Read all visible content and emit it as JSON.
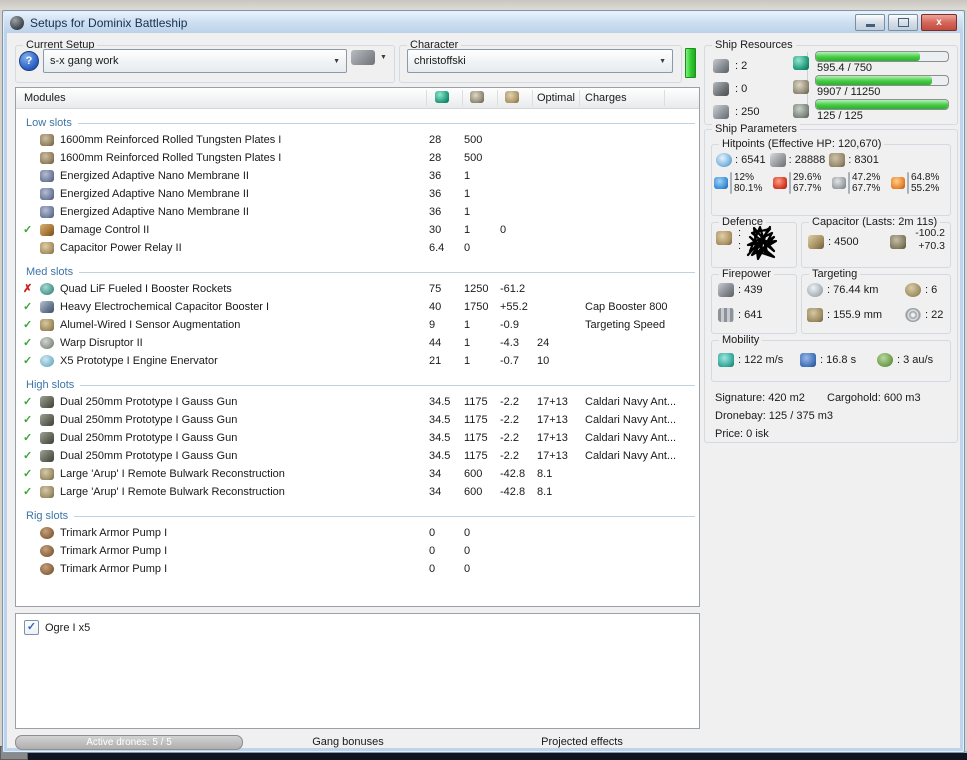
{
  "window": {
    "title": "Setups for Dominix Battleship"
  },
  "icons": {
    "help": "?",
    "dropdown": "▼",
    "check": "✓",
    "cross": "✗",
    "checkbox_check": "✓",
    "close": "x"
  },
  "current_setup": {
    "label": "Current Setup",
    "value": "s-x gang work"
  },
  "character": {
    "label": "Character",
    "value": "christoffski"
  },
  "ship_resources": {
    "label": "Ship Resources",
    "slots": [
      {
        "icon": "turret-hardpoints-icon",
        "value": ": 2"
      },
      {
        "icon": "launcher-hardpoints-icon",
        "value": ": 0"
      },
      {
        "icon": "calibration-icon",
        "value": ": 250"
      }
    ],
    "bars": [
      {
        "icon": "cpu-icon",
        "text": "595.4 / 750",
        "pct": 79
      },
      {
        "icon": "powergrid-icon",
        "text": "9907 / 11250",
        "pct": 88
      },
      {
        "icon": "dronebay-icon",
        "text": "125 / 125",
        "pct": 100
      }
    ]
  },
  "modules": {
    "header": {
      "title": "Modules",
      "optimal": "Optimal",
      "charges": "Charges",
      "icon_cols": [
        "cpu-icon",
        "powergrid-icon",
        "capacitor-icon"
      ]
    },
    "sections": [
      {
        "title": "Low slots",
        "rows": [
          {
            "status": "",
            "icon": "armor-plate-icon",
            "name": "1600mm Reinforced Rolled Tungsten Plates I",
            "cpu": "28",
            "pg": "500",
            "cap": "",
            "optimal": "",
            "charges": ""
          },
          {
            "status": "",
            "icon": "armor-plate-icon",
            "name": "1600mm Reinforced Rolled Tungsten Plates I",
            "cpu": "28",
            "pg": "500",
            "cap": "",
            "optimal": "",
            "charges": ""
          },
          {
            "status": "",
            "icon": "nano-membrane-icon",
            "name": "Energized Adaptive Nano Membrane II",
            "cpu": "36",
            "pg": "1",
            "cap": "",
            "optimal": "",
            "charges": ""
          },
          {
            "status": "",
            "icon": "nano-membrane-icon",
            "name": "Energized Adaptive Nano Membrane II",
            "cpu": "36",
            "pg": "1",
            "cap": "",
            "optimal": "",
            "charges": ""
          },
          {
            "status": "",
            "icon": "nano-membrane-icon",
            "name": "Energized Adaptive Nano Membrane II",
            "cpu": "36",
            "pg": "1",
            "cap": "",
            "optimal": "",
            "charges": ""
          },
          {
            "status": "check",
            "icon": "damage-control-icon",
            "name": "Damage Control II",
            "cpu": "30",
            "pg": "1",
            "cap": "0",
            "optimal": "",
            "charges": ""
          },
          {
            "status": "",
            "icon": "cap-relay-icon",
            "name": "Capacitor Power Relay II",
            "cpu": "6.4",
            "pg": "0",
            "cap": "",
            "optimal": "",
            "charges": ""
          }
        ]
      },
      {
        "title": "Med slots",
        "rows": [
          {
            "status": "cross",
            "icon": "afterburner-icon",
            "name": "Quad LiF Fueled I Booster Rockets",
            "cpu": "75",
            "pg": "1250",
            "cap": "-61.2",
            "optimal": "",
            "charges": ""
          },
          {
            "status": "check",
            "icon": "cap-booster-icon",
            "name": "Heavy Electrochemical Capacitor Booster I",
            "cpu": "40",
            "pg": "1750",
            "cap": "+55.2",
            "optimal": "",
            "charges": "Cap Booster 800"
          },
          {
            "status": "check",
            "icon": "sensor-augmentation-icon",
            "name": "Alumel-Wired I Sensor Augmentation",
            "cpu": "9",
            "pg": "1",
            "cap": "-0.9",
            "optimal": "",
            "charges": "Targeting Speed"
          },
          {
            "status": "check",
            "icon": "warp-disruptor-icon",
            "name": "Warp Disruptor II",
            "cpu": "44",
            "pg": "1",
            "cap": "-4.3",
            "optimal": "24",
            "charges": ""
          },
          {
            "status": "check",
            "icon": "stasis-web-icon",
            "name": "X5 Prototype I Engine Enervator",
            "cpu": "21",
            "pg": "1",
            "cap": "-0.7",
            "optimal": "10",
            "charges": ""
          }
        ]
      },
      {
        "title": "High slots",
        "rows": [
          {
            "status": "check",
            "icon": "gauss-gun-icon",
            "name": "Dual 250mm Prototype I Gauss Gun",
            "cpu": "34.5",
            "pg": "1175",
            "cap": "-2.2",
            "optimal": "17+13",
            "charges": "Caldari Navy Ant..."
          },
          {
            "status": "check",
            "icon": "gauss-gun-icon",
            "name": "Dual 250mm Prototype I Gauss Gun",
            "cpu": "34.5",
            "pg": "1175",
            "cap": "-2.2",
            "optimal": "17+13",
            "charges": "Caldari Navy Ant..."
          },
          {
            "status": "check",
            "icon": "gauss-gun-icon",
            "name": "Dual 250mm Prototype I Gauss Gun",
            "cpu": "34.5",
            "pg": "1175",
            "cap": "-2.2",
            "optimal": "17+13",
            "charges": "Caldari Navy Ant..."
          },
          {
            "status": "check",
            "icon": "gauss-gun-icon",
            "name": "Dual 250mm Prototype I Gauss Gun",
            "cpu": "34.5",
            "pg": "1175",
            "cap": "-2.2",
            "optimal": "17+13",
            "charges": "Caldari Navy Ant..."
          },
          {
            "status": "check",
            "icon": "remote-repair-icon",
            "name": "Large 'Arup' I Remote Bulwark Reconstruction",
            "cpu": "34",
            "pg": "600",
            "cap": "-42.8",
            "optimal": "8.1",
            "charges": ""
          },
          {
            "status": "check",
            "icon": "remote-repair-icon",
            "name": "Large 'Arup' I Remote Bulwark Reconstruction",
            "cpu": "34",
            "pg": "600",
            "cap": "-42.8",
            "optimal": "8.1",
            "charges": ""
          }
        ]
      },
      {
        "title": "Rig slots",
        "rows": [
          {
            "status": "",
            "icon": "rig-armor-icon",
            "name": "Trimark Armor Pump I",
            "cpu": "0",
            "pg": "0",
            "cap": "",
            "optimal": "",
            "charges": ""
          },
          {
            "status": "",
            "icon": "rig-armor-icon",
            "name": "Trimark Armor Pump I",
            "cpu": "0",
            "pg": "0",
            "cap": "",
            "optimal": "",
            "charges": ""
          },
          {
            "status": "",
            "icon": "rig-armor-icon",
            "name": "Trimark Armor Pump I",
            "cpu": "0",
            "pg": "0",
            "cap": "",
            "optimal": "",
            "charges": ""
          }
        ]
      }
    ]
  },
  "ship_parameters": {
    "label": "Ship Parameters",
    "hitpoints": {
      "label": "Hitpoints (Effective HP: 120,670)",
      "buffers": [
        {
          "icon": "shield-icon",
          "value": ": 6541"
        },
        {
          "icon": "armor-icon",
          "value": ": 28888"
        },
        {
          "icon": "structure-icon",
          "value": ": 8301"
        }
      ],
      "resists": [
        {
          "icon": "em-resist-icon",
          "shield": "12%",
          "armor": "80.1%"
        },
        {
          "icon": "thermal-resist-icon",
          "shield": "29.6%",
          "armor": "67.7%"
        },
        {
          "icon": "kinetic-resist-icon",
          "shield": "47.2%",
          "armor": "67.7%"
        },
        {
          "icon": "explosive-resist-icon",
          "shield": "64.8%",
          "armor": "55.2%"
        }
      ]
    },
    "defence": {
      "label": "Defence",
      "line1": ":",
      "line2": ":"
    },
    "capacitor": {
      "label": "Capacitor (Lasts: 2m 11s)",
      "amount": ": 4500",
      "drain": "-100.2",
      "recharge": "+70.3"
    },
    "firepower": {
      "label": "Firepower",
      "rows": [
        {
          "icon": "turret-damage-icon",
          "value": ": 439"
        },
        {
          "icon": "dps-icon",
          "value": ": 641"
        }
      ]
    },
    "targeting": {
      "label": "Targeting",
      "rows": [
        {
          "icon": "targeting-range-icon",
          "value": ": 76.44 km"
        },
        {
          "icon": "max-targets-icon",
          "value": ": 6"
        },
        {
          "icon": "scan-resolution-icon",
          "value": ": 155.9 mm"
        },
        {
          "icon": "sensor-strength-icon",
          "value": ": 22"
        }
      ]
    },
    "mobility": {
      "label": "Mobility",
      "rows": [
        {
          "icon": "speed-icon",
          "value": ": 122 m/s"
        },
        {
          "icon": "align-time-icon",
          "value": ": 16.8 s"
        },
        {
          "icon": "warp-speed-icon",
          "value": ": 3 au/s"
        }
      ]
    },
    "stats": {
      "signature": "Signature: 420 m2",
      "cargohold": "Cargohold: 600 m3",
      "dronebay": "Dronebay: 125 / 375 m3",
      "price": "Price: 0 isk"
    }
  },
  "drones": {
    "items": [
      {
        "checked": true,
        "label": "Ogre I x5"
      }
    ]
  },
  "bottom_bar": {
    "active_drones": "Active drones: 5 / 5",
    "gang_bonuses": "Gang bonuses",
    "projected_effects": "Projected effects"
  },
  "colors": {
    "resource_bar": "#3ec43e",
    "section_title": "#3c74a6",
    "close_button": "#c9594a"
  }
}
